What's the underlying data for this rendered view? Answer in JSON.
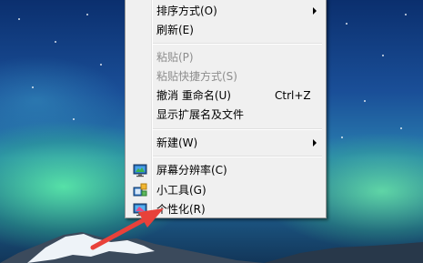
{
  "context_menu": {
    "items": [
      {
        "label": "排序方式(O)",
        "shortcut": "",
        "disabled": false,
        "submenu": true,
        "icon": ""
      },
      {
        "label": "刷新(E)",
        "shortcut": "",
        "disabled": false,
        "submenu": false,
        "icon": ""
      },
      {
        "label": "粘贴(P)",
        "shortcut": "",
        "disabled": true,
        "submenu": false,
        "icon": ""
      },
      {
        "label": "粘贴快捷方式(S)",
        "shortcut": "",
        "disabled": true,
        "submenu": false,
        "icon": ""
      },
      {
        "label": "撤消 重命名(U)",
        "shortcut": "Ctrl+Z",
        "disabled": false,
        "submenu": false,
        "icon": ""
      },
      {
        "label": "显示扩展名及文件",
        "shortcut": "",
        "disabled": false,
        "submenu": false,
        "icon": ""
      },
      {
        "label": "新建(W)",
        "shortcut": "",
        "disabled": false,
        "submenu": true,
        "icon": ""
      },
      {
        "label": "屏幕分辨率(C)",
        "shortcut": "",
        "disabled": false,
        "submenu": false,
        "icon": "screen-resolution-icon"
      },
      {
        "label": "小工具(G)",
        "shortcut": "",
        "disabled": false,
        "submenu": false,
        "icon": "gadgets-icon"
      },
      {
        "label": "个性化(R)",
        "shortcut": "",
        "disabled": false,
        "submenu": false,
        "icon": "personalize-icon"
      }
    ]
  },
  "annotation": {
    "arrow_color": "#e8413a"
  },
  "colors": {
    "menu_background": "#f0f0f0",
    "disabled_text": "#8d8d8d"
  }
}
